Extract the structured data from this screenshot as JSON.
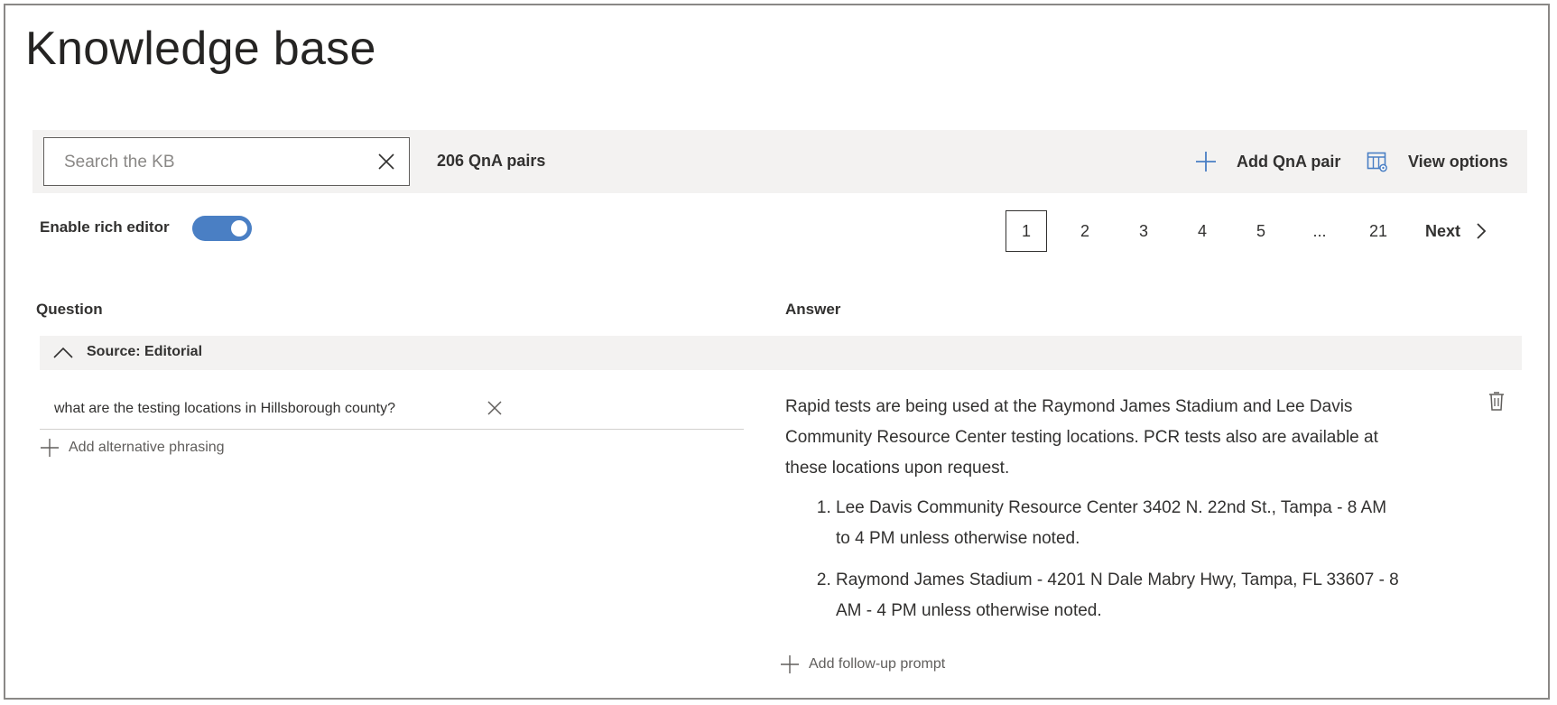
{
  "page": {
    "title": "Knowledge base"
  },
  "toolbar": {
    "search_placeholder": "Search the KB",
    "search_value": "",
    "qna_count": "206 QnA pairs",
    "add_pair_label": "Add QnA pair",
    "view_options_label": "View options"
  },
  "editor": {
    "rich_editor_label": "Enable rich editor",
    "rich_editor_enabled": true
  },
  "pagination": {
    "pages": [
      "1",
      "2",
      "3",
      "4",
      "5",
      "...",
      "21"
    ],
    "current": "1",
    "next_label": "Next"
  },
  "table": {
    "question_header": "Question",
    "answer_header": "Answer",
    "group_label": "Source: Editorial",
    "row": {
      "question": "what are the testing locations in Hillsborough county?",
      "add_alternative_label": "Add alternative phrasing",
      "answer_intro": "Rapid tests are being used at the Raymond James Stadium and Lee Davis Community Resource Center testing locations. PCR tests also are available at these locations upon request.",
      "answer_items": [
        "Lee Davis Community Resource Center 3402 N. 22nd St., Tampa - 8 AM to 4 PM unless otherwise noted.",
        "Raymond James Stadium - 4201 N Dale Mabry Hwy, Tampa, FL 33607 - 8 AM - 4 PM unless otherwise noted."
      ],
      "add_follow_up_label": "Add follow-up prompt"
    }
  },
  "colors": {
    "accent": "#4a7fc4",
    "toolbar_bg": "#f3f2f1",
    "text": "#323130"
  },
  "icons": [
    "close-icon",
    "plus-icon",
    "view-options-icon",
    "chevron-right-icon",
    "chevron-up-icon",
    "trash-icon"
  ]
}
